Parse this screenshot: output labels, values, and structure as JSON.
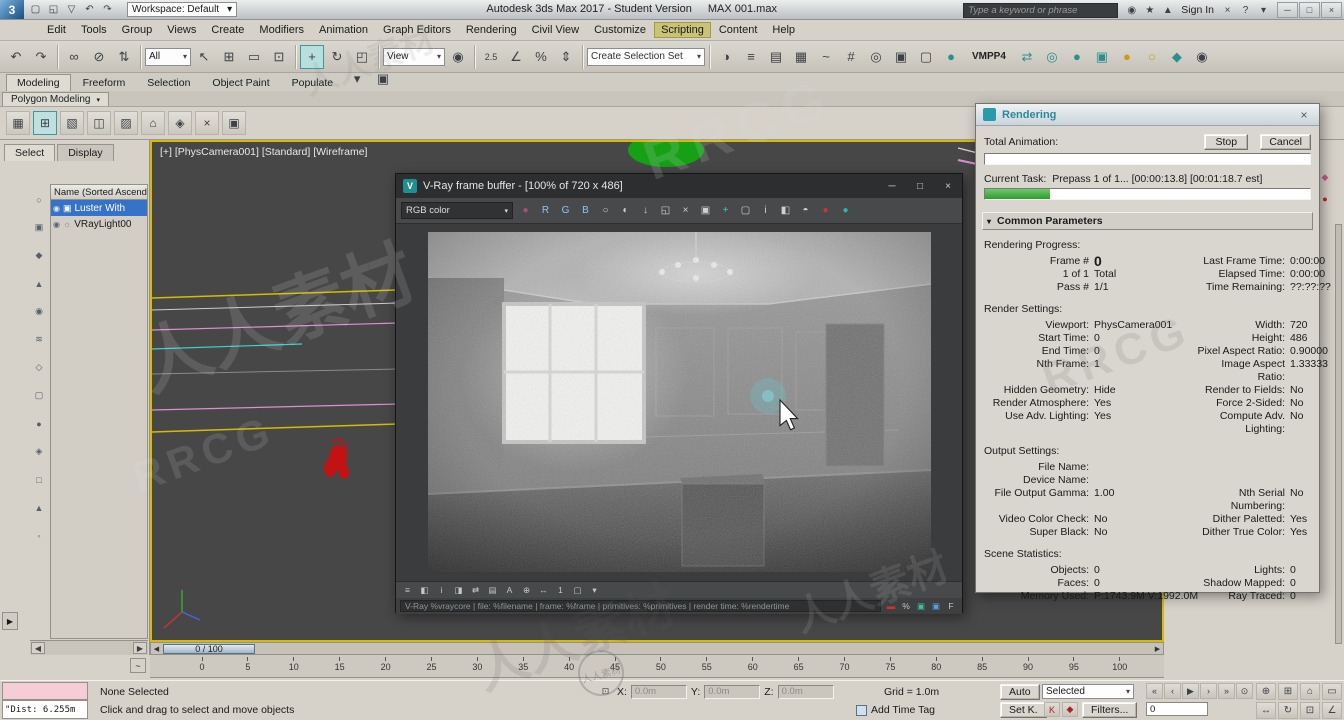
{
  "titlebar": {
    "app_logo": "3",
    "workspace": "Workspace: Default",
    "app_title": "Autodesk 3ds Max 2017 - Student Version",
    "doc_title": "MAX 001.max",
    "search_placeholder": "Type a keyword or phrase",
    "sign_in": "Sign In",
    "quick_icons": [
      {
        "name": "new-file-icon",
        "glyph": "▢"
      },
      {
        "name": "open-file-icon",
        "glyph": "◱"
      },
      {
        "name": "save-file-icon",
        "glyph": "▽"
      },
      {
        "name": "undo-quick-icon",
        "glyph": "↶"
      },
      {
        "name": "redo-quick-icon",
        "glyph": "↷"
      }
    ],
    "right_icons": [
      {
        "name": "community-icon",
        "glyph": "◉"
      },
      {
        "name": "favorites-icon",
        "glyph": "★"
      },
      {
        "name": "notifications-icon",
        "glyph": "▲"
      }
    ],
    "after_signin_icons": [
      {
        "name": "autodesk-exchange-icon",
        "glyph": "×"
      },
      {
        "name": "help-icon",
        "glyph": "?"
      },
      {
        "name": "workspace-menu-icon",
        "glyph": "▾"
      }
    ],
    "window_buttons": [
      {
        "name": "minimize-button",
        "glyph": "─"
      },
      {
        "name": "maximize-button",
        "glyph": "□"
      },
      {
        "name": "close-button",
        "glyph": "×"
      }
    ]
  },
  "menubar": {
    "items": [
      "Edit",
      "Tools",
      "Group",
      "Views",
      "Create",
      "Modifiers",
      "Animation",
      "Graph Editors",
      "Rendering",
      "Civil View",
      "Customize",
      "Scripting",
      "Content",
      "Help"
    ],
    "highlighted": "Scripting"
  },
  "toolbar": {
    "filter_value": "All",
    "view_value": "View",
    "create_selection_set": "Create Selection Set",
    "named_set": "VMPP4",
    "group_history": [
      {
        "name": "undo-icon",
        "glyph": "↶"
      },
      {
        "name": "redo-icon",
        "glyph": "↷"
      }
    ],
    "group_link": [
      {
        "name": "select-and-link-icon",
        "glyph": "∞"
      },
      {
        "name": "unlink-selection-icon",
        "glyph": "⊘"
      },
      {
        "name": "bind-to-space-warp-icon",
        "glyph": "⇅"
      }
    ],
    "group_select": [
      {
        "name": "select-object-icon",
        "glyph": "↖"
      },
      {
        "name": "select-by-name-icon",
        "glyph": "⊞"
      },
      {
        "name": "selection-region-icon",
        "glyph": "▭"
      },
      {
        "name": "window-crossing-icon",
        "glyph": "⊡"
      }
    ],
    "group_transform": [
      {
        "name": "select-and-move-icon",
        "glyph": "+",
        "active": true
      },
      {
        "name": "select-and-rotate-icon",
        "glyph": "↻"
      },
      {
        "name": "select-and-scale-icon",
        "glyph": "◰"
      }
    ],
    "group_pivot": [
      {
        "name": "use-pivot-point-icon",
        "glyph": "◉"
      }
    ],
    "group_snaps": [
      {
        "name": "snaps-toggle-icon",
        "glyph": "2.5"
      },
      {
        "name": "angle-snap-icon",
        "glyph": "∠"
      },
      {
        "name": "percent-snap-icon",
        "glyph": "%"
      },
      {
        "name": "spinner-snap-icon",
        "glyph": "⇕"
      }
    ],
    "group_tools": [
      {
        "name": "mirror-icon",
        "glyph": "◑"
      },
      {
        "name": "align-icon",
        "glyph": "≡"
      },
      {
        "name": "layer-manager-icon",
        "glyph": "▤"
      },
      {
        "name": "graphite-ribbon-icon",
        "glyph": "▦"
      },
      {
        "name": "curve-editor-icon",
        "glyph": "~"
      },
      {
        "name": "schematic-view-icon",
        "glyph": "#"
      },
      {
        "name": "material-editor-icon",
        "glyph": "◎"
      },
      {
        "name": "render-setup-icon",
        "glyph": "▣"
      },
      {
        "name": "rendered-frame-window-icon",
        "glyph": "▢"
      },
      {
        "name": "render-production-icon",
        "glyph": "●",
        "color": "#2a8f8f"
      }
    ],
    "group_right": [
      {
        "name": "scene-converter-icon",
        "glyph": "⇄",
        "color": "#2a8f8f"
      },
      {
        "name": "render-gallery-icon",
        "glyph": "◎",
        "color": "#2a8f8f"
      },
      {
        "name": "cloud-render-icon",
        "glyph": "●",
        "color": "#2a8f8f"
      },
      {
        "name": "grab-viewport-icon",
        "glyph": "▣",
        "color": "#2a8f8f"
      },
      {
        "name": "render-teapot-icon",
        "glyph": "●",
        "color": "#c79a2a"
      },
      {
        "name": "lightbulb-icon",
        "glyph": "○",
        "color": "#c79a2a"
      },
      {
        "name": "material-library-icon",
        "glyph": "◆",
        "color": "#2a8f8f"
      },
      {
        "name": "help-search-icon",
        "glyph": "◉"
      }
    ]
  },
  "ribbon": {
    "tabs": [
      "Modeling",
      "Freeform",
      "Selection",
      "Object Paint",
      "Populate"
    ],
    "active": "Modeling",
    "panel_tab": "Polygon Modeling",
    "overflow_icons": [
      {
        "name": "ribbon-overflow-icon",
        "glyph": "▾"
      },
      {
        "name": "ribbon-config-icon",
        "glyph": "▣"
      }
    ],
    "tool_icons": [
      {
        "name": "polygon-modeling-tool-icon",
        "glyph": "▦"
      },
      {
        "name": "polygon-modeling-tool-icon",
        "glyph": "⊞",
        "active": true
      },
      {
        "name": "polygon-modeling-tool-icon",
        "glyph": "▧"
      },
      {
        "name": "polygon-modeling-tool-icon",
        "glyph": "◫"
      },
      {
        "name": "polygon-modeling-tool-icon",
        "glyph": "▨"
      },
      {
        "name": "polygon-modeling-tool-icon",
        "glyph": "⌂"
      },
      {
        "name": "polygon-modeling-tool-icon",
        "glyph": "◈"
      },
      {
        "name": "polygon-modeling-tool-icon",
        "glyph": "×"
      },
      {
        "name": "polygon-modeling-tool-icon",
        "glyph": "▣"
      }
    ]
  },
  "scene_explorer": {
    "tabs": [
      "Select",
      "Display"
    ],
    "active_tab": "Select",
    "header": "Name (Sorted Ascendi",
    "items": [
      {
        "label": "Luster With",
        "selected": true,
        "type": "geometry",
        "glyph": "▣"
      },
      {
        "label": "VRayLight00",
        "selected": false,
        "type": "light",
        "glyph": "☼"
      }
    ],
    "filter_icons": [
      {
        "name": "filter-geometry-icon",
        "glyph": "○"
      },
      {
        "name": "filter-shapes-icon",
        "glyph": "▣"
      },
      {
        "name": "filter-lights-icon",
        "glyph": "◆"
      },
      {
        "name": "filter-cameras-icon",
        "glyph": "▲"
      },
      {
        "name": "filter-helpers-icon",
        "glyph": "◉"
      },
      {
        "name": "filter-spacewarps-icon",
        "glyph": "≋"
      },
      {
        "name": "filter-groups-icon",
        "glyph": "◇"
      },
      {
        "name": "filter-xrefs-icon",
        "glyph": "▢"
      },
      {
        "name": "filter-bones-icon",
        "glyph": "●"
      },
      {
        "name": "filter-containers-icon",
        "glyph": "◈"
      },
      {
        "name": "filter-materials-icon",
        "glyph": "□"
      },
      {
        "name": "sort-icon",
        "glyph": "▲"
      },
      {
        "name": "explorer-settings-icon",
        "glyph": "◦"
      }
    ]
  },
  "viewport": {
    "label": "[+] [PhysCamera001] [Standard] [Wireframe]"
  },
  "command_panel": {
    "tab_icons": [
      {
        "name": "create-tab-icon",
        "glyph": "+"
      },
      {
        "name": "modify-tab-icon",
        "glyph": "↺"
      },
      {
        "name": "hierarchy-tab-icon",
        "glyph": "≋"
      },
      {
        "name": "motion-tab-icon",
        "glyph": "◉"
      },
      {
        "name": "display-tab-icon",
        "glyph": "▢"
      },
      {
        "name": "utilities-tab-icon",
        "glyph": "*"
      }
    ],
    "mini_icons": [
      {
        "name": "panel-mini-icon",
        "glyph": "◆",
        "color": "#d0568a"
      },
      {
        "name": "panel-mini-icon",
        "glyph": "●",
        "color": "#c22222"
      }
    ]
  },
  "vfb": {
    "title": "V-Ray frame buffer - [100% of 720 x 486]",
    "channel": "RGB color",
    "stamp": "V-Ray %vraycore | file: %filename | frame: %frame | primitives: %primitives | render time: %rendertime",
    "window_buttons": [
      {
        "name": "vfb-minimize-button",
        "glyph": "─"
      },
      {
        "name": "vfb-maximize-button",
        "glyph": "□"
      },
      {
        "name": "vfb-close-button",
        "glyph": "×"
      }
    ],
    "top_icons": [
      {
        "name": "vfb-color-swatch-icon",
        "glyph": "●",
        "color": "#b24a7a"
      },
      {
        "name": "red-channel-button",
        "glyph": "R",
        "color": "#8fc2f2"
      },
      {
        "name": "green-channel-button",
        "glyph": "G",
        "color": "#8fc2f2"
      },
      {
        "name": "blue-channel-button",
        "glyph": "B",
        "color": "#8fc2f2"
      },
      {
        "name": "alpha-channel-button",
        "glyph": "○"
      },
      {
        "name": "monochrome-button",
        "glyph": "◐"
      },
      {
        "name": "save-image-icon",
        "glyph": "↓"
      },
      {
        "name": "load-image-icon",
        "glyph": "◱"
      },
      {
        "name": "clear-image-icon",
        "glyph": "×"
      },
      {
        "name": "duplicate-to-host-icon",
        "glyph": "▣"
      },
      {
        "name": "track-mouse-icon",
        "glyph": "+",
        "color": "#49c0c0"
      },
      {
        "name": "region-render-icon",
        "glyph": "▢"
      },
      {
        "name": "pixel-info-icon",
        "glyph": "i"
      },
      {
        "name": "compare-horizontal-icon",
        "glyph": "◧"
      },
      {
        "name": "compare-vertical-icon",
        "glyph": "◓"
      },
      {
        "name": "stop-render-icon",
        "glyph": "●",
        "color": "#d03333"
      },
      {
        "name": "render-last-icon",
        "glyph": "●",
        "color": "#2ab5b5"
      }
    ],
    "bottom_icons": [
      {
        "name": "vfb-stamp-toggle-icon",
        "glyph": "≡"
      },
      {
        "name": "vfb-alpha-view-icon",
        "glyph": "◧"
      },
      {
        "name": "vfb-info-icon",
        "glyph": "i"
      },
      {
        "name": "vfb-compare-icon",
        "glyph": "◨"
      },
      {
        "name": "vfb-swap-icon",
        "glyph": "⇄"
      },
      {
        "name": "vfb-history-icon",
        "glyph": "▤"
      },
      {
        "name": "vfb-ab-icon",
        "glyph": "A"
      },
      {
        "name": "vfb-zoom-icon",
        "glyph": "⊕"
      },
      {
        "name": "vfb-pan-icon",
        "glyph": "↔"
      },
      {
        "name": "vfb-one-to-one-icon",
        "glyph": "1"
      },
      {
        "name": "vfb-fit-icon",
        "glyph": "▢"
      },
      {
        "name": "vfb-menu-icon",
        "glyph": "▾"
      }
    ],
    "stamp_icons": [
      {
        "name": "stamp-edit-icon",
        "glyph": "▬",
        "color": "#cc3333"
      },
      {
        "name": "stamp-percent-icon",
        "glyph": "%"
      },
      {
        "name": "stamp-green-icon",
        "glyph": "▣",
        "color": "#3fbf9f"
      },
      {
        "name": "stamp-blue-icon",
        "glyph": "▣",
        "color": "#5aa0dd"
      },
      {
        "name": "stamp-font-icon",
        "glyph": "F"
      }
    ]
  },
  "render_dialog": {
    "title": "Rendering",
    "total_animation_label": "Total Animation:",
    "stop": "Stop",
    "cancel": "Cancel",
    "current_task_label": "Current Task:",
    "current_task": "Prepass 1 of 1... [00:00:13.8] [00:01:18.7 est]",
    "common_header": "Common Parameters",
    "progress_percent": 20,
    "sections": [
      {
        "header": "Rendering Progress:",
        "rows": [
          {
            "ll": "Frame #",
            "lv": "0",
            "rl": "Last Frame Time:",
            "rv": "0:00:00",
            "big": true
          },
          {
            "ll": "1 of 1",
            "lv": "Total",
            "rl": "Elapsed Time:",
            "rv": "0:00:00"
          },
          {
            "ll": "Pass #",
            "lv": "1/1",
            "rl": "Time Remaining:",
            "rv": "??:??:??"
          }
        ]
      },
      {
        "header": "Render Settings:",
        "rows": [
          {
            "ll": "Viewport:",
            "lv": "PhysCamera001",
            "rl": "Width:",
            "rv": "720"
          },
          {
            "ll": "Start Time:",
            "lv": "0",
            "rl": "Height:",
            "rv": "486"
          },
          {
            "ll": "End Time:",
            "lv": "0",
            "rl": "Pixel Aspect Ratio:",
            "rv": "0.90000"
          },
          {
            "ll": "Nth Frame:",
            "lv": "1",
            "rl": "Image Aspect Ratio:",
            "rv": "1.33333"
          },
          {
            "ll": "Hidden Geometry:",
            "lv": "Hide",
            "rl": "Render to Fields:",
            "rv": "No"
          },
          {
            "ll": "Render Atmosphere:",
            "lv": "Yes",
            "rl": "Force 2-Sided:",
            "rv": "No"
          },
          {
            "ll": "Use Adv. Lighting:",
            "lv": "Yes",
            "rl": "Compute Adv. Lighting:",
            "rv": "No"
          }
        ]
      },
      {
        "header": "Output Settings:",
        "rows": [
          {
            "ll": "File Name:",
            "lv": "",
            "rl": "",
            "rv": ""
          },
          {
            "ll": "Device Name:",
            "lv": "",
            "rl": "",
            "rv": ""
          },
          {
            "ll": "File Output Gamma:",
            "lv": "1.00",
            "rl": "Nth Serial Numbering:",
            "rv": "No"
          },
          {
            "ll": "Video Color Check:",
            "lv": "No",
            "rl": "Dither Paletted:",
            "rv": "Yes"
          },
          {
            "ll": "Super Black:",
            "lv": "No",
            "rl": "Dither True Color:",
            "rv": "Yes"
          }
        ]
      },
      {
        "header": "Scene Statistics:",
        "rows": [
          {
            "ll": "Objects:",
            "lv": "0",
            "rl": "Lights:",
            "rv": "0"
          },
          {
            "ll": "Faces:",
            "lv": "0",
            "rl": "Shadow Mapped:",
            "rv": "0"
          },
          {
            "ll": "Memory Used:",
            "lv": "P:1743.9M V:1992.0M",
            "rl": "Ray Traced:",
            "rv": "0"
          }
        ]
      }
    ]
  },
  "timeline": {
    "slider_label": "0 / 100",
    "ticks": [
      "0",
      "5",
      "10",
      "15",
      "20",
      "25",
      "30",
      "35",
      "40",
      "45",
      "50",
      "55",
      "60",
      "65",
      "70",
      "75",
      "80",
      "85",
      "90",
      "95",
      "100"
    ]
  },
  "statusbar": {
    "listener_text": "\"Dist: 6.255m",
    "selection_status": "None Selected",
    "prompt": "Click and drag to select and move objects",
    "x_label": "X:",
    "y_label": "Y:",
    "z_label": "Z:",
    "coord_value": "0.0m",
    "grid_label": "Grid = 1.0m",
    "add_time_tag": "Add Time Tag",
    "auto_key": "Auto",
    "selected_dd": "Selected",
    "set_key": "Set K.",
    "filters": "Filters...",
    "frame_field": "0",
    "key_icons": [
      {
        "name": "set-key-icon",
        "glyph": "K",
        "color": "#aa2222"
      },
      {
        "name": "new-key-icon",
        "glyph": "◆",
        "color": "#aa2222"
      }
    ],
    "transport": [
      {
        "name": "go-to-start-button",
        "glyph": "«"
      },
      {
        "name": "previous-frame-button",
        "glyph": "‹"
      },
      {
        "name": "play-button",
        "glyph": "▶"
      },
      {
        "name": "next-frame-button",
        "glyph": "›"
      },
      {
        "name": "go-to-end-button",
        "glyph": "»"
      },
      {
        "name": "time-config-button",
        "glyph": "⊙"
      }
    ],
    "nav_icons": [
      {
        "name": "zoom-icon",
        "glyph": "⊕"
      },
      {
        "name": "zoom-all-icon",
        "glyph": "⊞"
      },
      {
        "name": "zoom-extents-icon",
        "glyph": "⌂"
      },
      {
        "name": "zoom-region-icon",
        "glyph": "▭"
      },
      {
        "name": "pan-icon",
        "glyph": "↔"
      },
      {
        "name": "orbit-icon",
        "glyph": "↻"
      },
      {
        "name": "maximize-viewport-icon",
        "glyph": "⊡"
      },
      {
        "name": "fov-icon",
        "glyph": "∠"
      }
    ]
  },
  "watermark": {
    "cn": "人人素材",
    "en": "RRCG",
    "logo": "人人素材"
  }
}
